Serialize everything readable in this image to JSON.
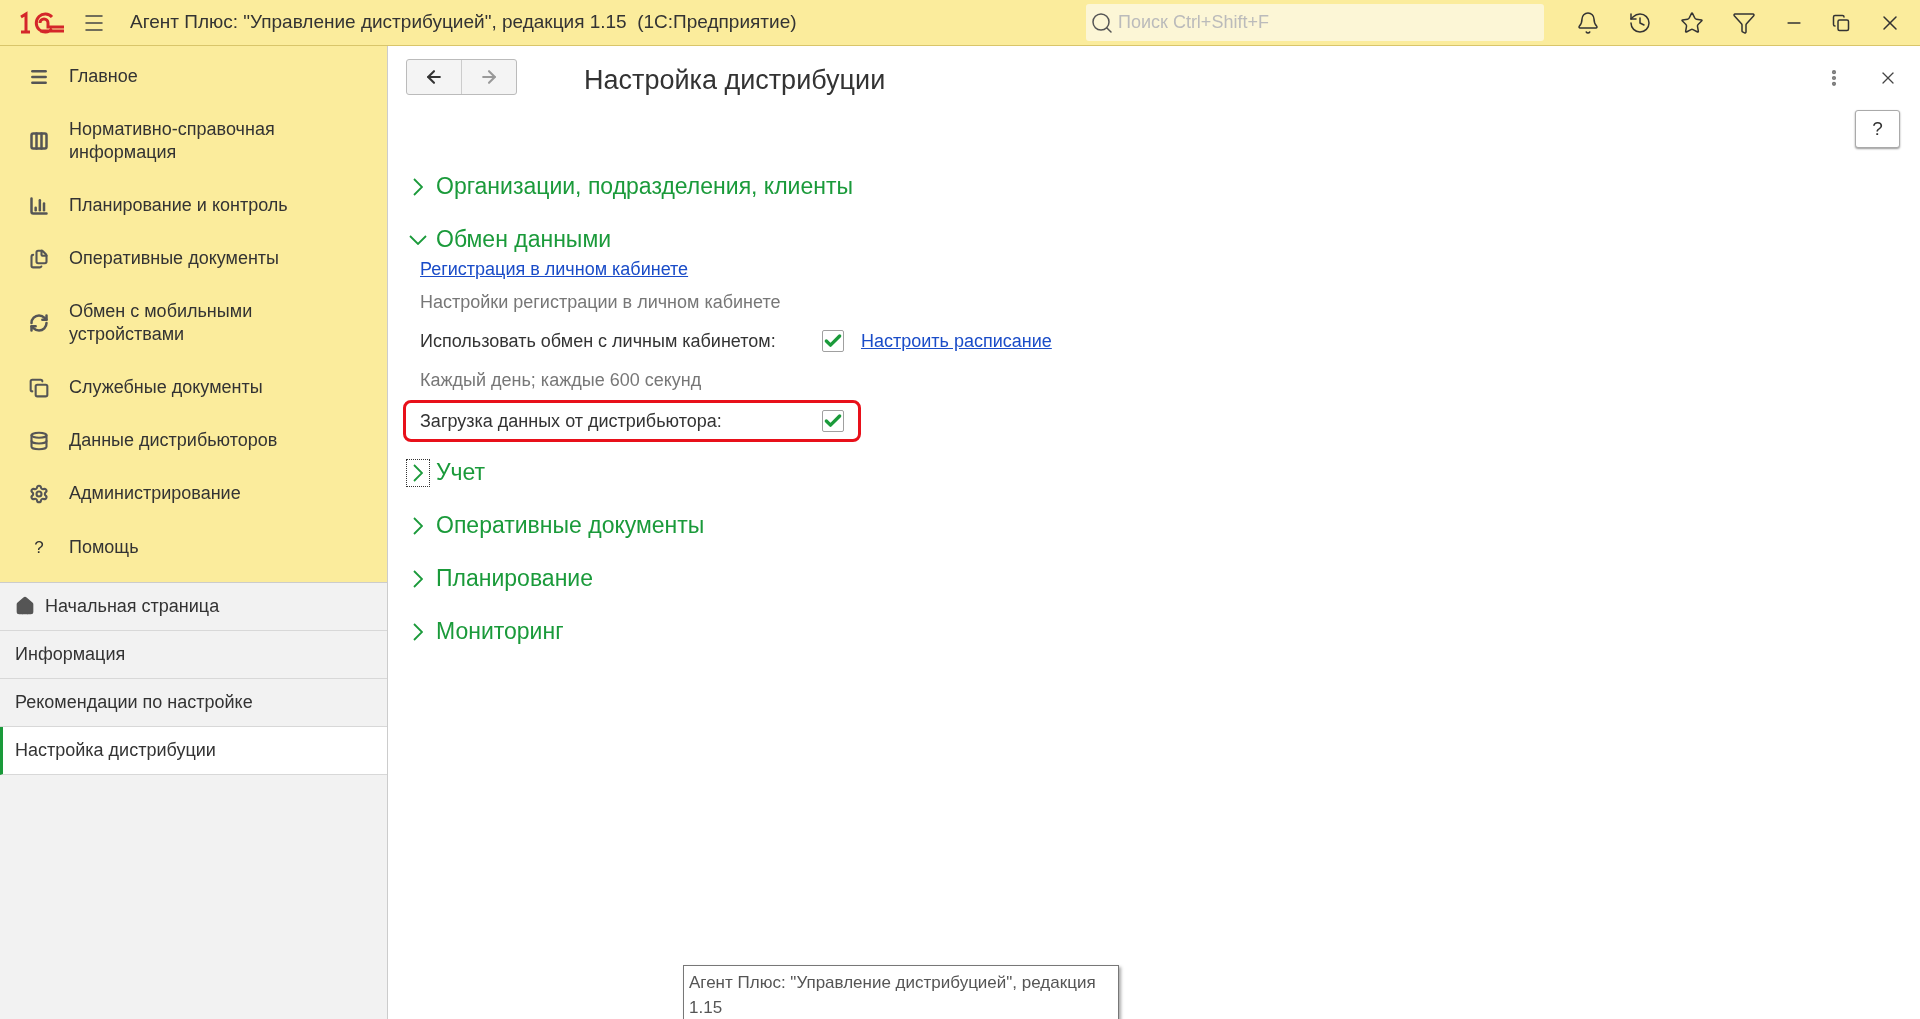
{
  "titlebar": {
    "title": "Агент Плюс: \"Управление дистрибуцией\", редакция 1.15  (1С:Предприятие)",
    "search": {
      "placeholder": "Поиск Ctrl+Shift+F"
    }
  },
  "sidebar": {
    "sections": [
      {
        "label": "Главное"
      },
      {
        "label": "Нормативно-справочная информация"
      },
      {
        "label": "Планирование и контроль"
      },
      {
        "label": "Оперативные документы"
      },
      {
        "label": "Обмен с мобильными устройствами"
      },
      {
        "label": "Служебные документы"
      },
      {
        "label": "Данные дистрибьюторов"
      },
      {
        "label": "Администрирование"
      },
      {
        "label": "Помощь",
        "glyph": "?"
      }
    ],
    "open_windows": [
      {
        "kind": "home",
        "label": "Начальная страница",
        "selected": false
      },
      {
        "kind": "window",
        "label": "Информация",
        "selected": false
      },
      {
        "kind": "window",
        "label": "Рекомендации по настройке",
        "selected": false
      },
      {
        "kind": "window",
        "label": "Настройка дистрибуции",
        "selected": true
      }
    ]
  },
  "form": {
    "title": "Настройка дистрибуции",
    "help_button": "?",
    "groups": [
      {
        "label": "Организации, подразделения, клиенты",
        "expanded": false,
        "focused": false
      },
      {
        "label": "Обмен данными",
        "expanded": true,
        "focused": false,
        "items": [
          {
            "kind": "link",
            "text": "Регистрация в личном кабинете"
          },
          {
            "kind": "note",
            "text": "Настройки регистрации в личном кабинете"
          },
          {
            "kind": "checkbox",
            "label": "Использовать обмен с личным кабинетом:",
            "checked": true,
            "highlighted": false,
            "link": "Настроить расписание"
          },
          {
            "kind": "note",
            "text": "Каждый день; каждые 600 секунд"
          },
          {
            "kind": "checkbox",
            "label": "Загрузка данных от дистрибьютора:",
            "checked": true,
            "highlighted": true
          }
        ]
      },
      {
        "label": "Учет",
        "expanded": false,
        "focused": true
      },
      {
        "label": "Оперативные документы",
        "expanded": false,
        "focused": false
      },
      {
        "label": "Планирование",
        "expanded": false,
        "focused": false
      },
      {
        "label": "Мониторинг",
        "expanded": false,
        "focused": false
      }
    ]
  },
  "tooltip": {
    "text": "Агент Плюс: \"Управление дистрибуцией\", редакция 1.15"
  }
}
